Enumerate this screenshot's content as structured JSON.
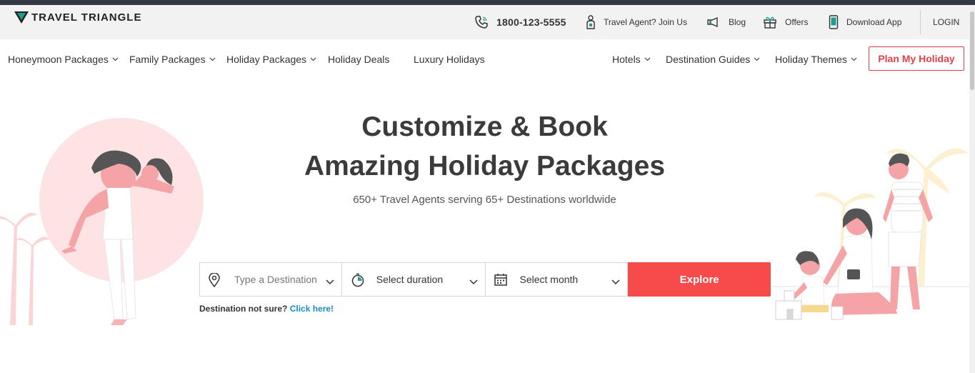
{
  "brand": {
    "name": "TRAVEL TRIANGLE",
    "accent": "#f74b4b",
    "teal": "#1f9e8f"
  },
  "header": {
    "phone": "1800-123-5555",
    "agent_join": "Travel Agent? Join Us",
    "blog": "Blog",
    "offers": "Offers",
    "download_app": "Download App",
    "login": "LOGIN"
  },
  "nav": {
    "items": [
      {
        "label": "Honeymoon Packages",
        "has_dropdown": true
      },
      {
        "label": "Family Packages",
        "has_dropdown": true
      },
      {
        "label": "Holiday Packages",
        "has_dropdown": true
      },
      {
        "label": "Holiday Deals",
        "has_dropdown": false
      },
      {
        "label": "Luxury Holidays",
        "has_dropdown": false
      },
      {
        "label": "Hotels",
        "has_dropdown": true
      },
      {
        "label": "Destination Guides",
        "has_dropdown": true
      },
      {
        "label": "Holiday Themes",
        "has_dropdown": true
      }
    ],
    "cta": "Plan My Holiday"
  },
  "hero": {
    "title_line1": "Customize & Book",
    "title_line2": "Amazing Holiday Packages",
    "subtitle": "650+ Travel Agents serving 65+ Destinations worldwide"
  },
  "search": {
    "destination_placeholder": "Type a Destination",
    "duration_label": "Select duration",
    "month_label": "Select month",
    "explore_label": "Explore",
    "note_prefix": "Destination not sure?",
    "note_link": "Click here!"
  },
  "icons": {
    "phone": "phone-icon",
    "agent": "agent-icon",
    "blog": "megaphone-icon",
    "offers": "gift-icon",
    "app": "mobile-icon",
    "destination": "location-pin-icon",
    "duration": "stopwatch-icon",
    "month": "calendar-icon"
  }
}
